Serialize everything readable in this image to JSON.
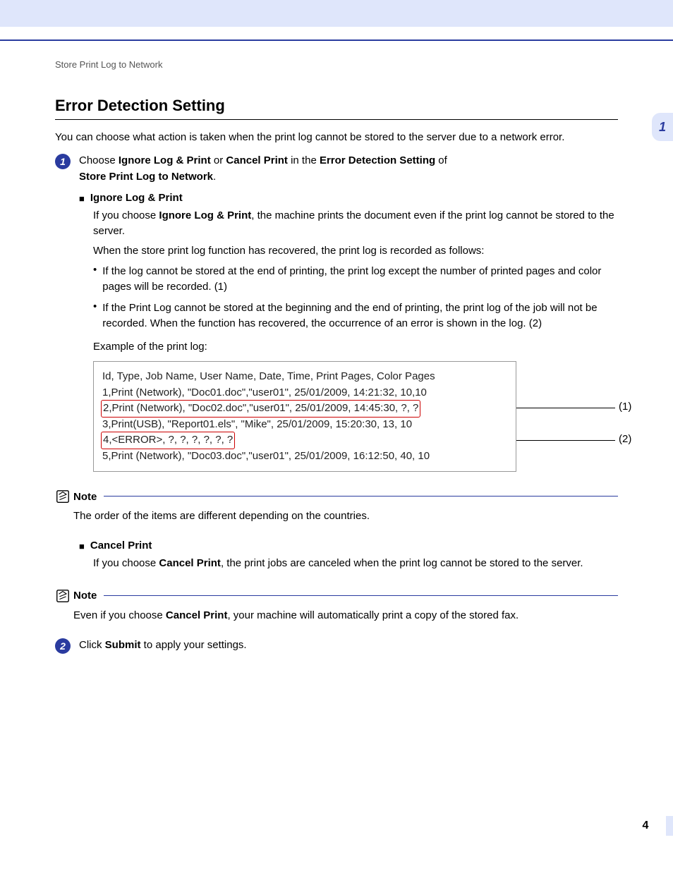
{
  "breadcrumb": "Store Print Log to Network",
  "chapter_tab": "1",
  "page_number": "4",
  "heading": "Error Detection Setting",
  "intro": "You can choose what action is taken when the print log cannot be stored to the server due to a network error.",
  "step1": {
    "num": "1",
    "p1a": "Choose ",
    "p1b": "Ignore Log & Print",
    "p1c": " or ",
    "p1d": "Cancel Print",
    "p1e": " in the ",
    "p1f": "Error Detection Setting",
    "p1g": " of ",
    "p1h": "Store Print Log to Network",
    "p1i": ".",
    "ignore_title": "Ignore Log & Print",
    "ignore_p1a": "If you choose ",
    "ignore_p1b": "Ignore Log & Print",
    "ignore_p1c": ", the machine prints the document even if the print log cannot be stored to the server.",
    "ignore_p2": "When the store print log function has recovered, the print log is recorded as follows:",
    "b1": "If the log cannot be stored at the end of printing, the print log except the number of printed pages and color pages will be recorded. (1)",
    "b2": "If the Print Log cannot be stored at the beginning and the end of printing, the print log of the job will not be recorded. When the function has recovered, the occurrence of an error is shown in the log. (2)",
    "example_label": "Example of the print log:",
    "log": {
      "l0": "Id, Type, Job Name, User Name, Date, Time, Print Pages, Color Pages",
      "l1": "1,Print (Network), \"Doc01.doc\",\"user01\", 25/01/2009, 14:21:32, 10,10",
      "l2": "2,Print (Network), \"Doc02.doc\",\"user01\", 25/01/2009, 14:45:30, ?, ?",
      "l3": "3,Print(USB), \"Report01.els\", \"Mike\", 25/01/2009, 15:20:30, 13, 10",
      "l4": "4,<ERROR>, ?, ?, ?, ?, ?, ?",
      "l5": "5,Print (Network), \"Doc03.doc\",\"user01\", 25/01/2009, 16:12:50, 40, 10",
      "c1": "(1)",
      "c2": "(2)"
    },
    "cancel_title": "Cancel Print",
    "cancel_p1a": "If you choose ",
    "cancel_p1b": "Cancel Print",
    "cancel_p1c": ", the print jobs are canceled when the print log cannot be stored to the server."
  },
  "note1": {
    "title": "Note",
    "text": "The order of the items are different depending on the countries."
  },
  "note2": {
    "title": "Note",
    "t1": "Even if you choose ",
    "t2": "Cancel Print",
    "t3": ", your machine will automatically print a copy of the stored fax."
  },
  "step2": {
    "num": "2",
    "t1": "Click ",
    "t2": "Submit",
    "t3": " to apply your settings."
  }
}
